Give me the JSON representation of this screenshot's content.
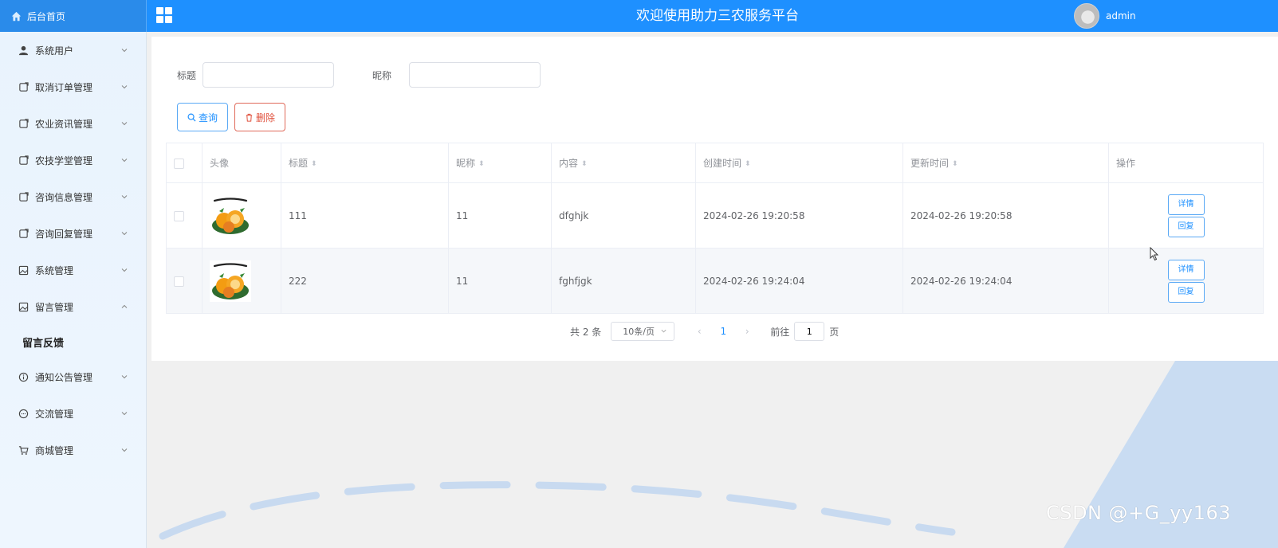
{
  "header": {
    "brand_label": "后台首页",
    "title": "欢迎使用助力三农服务平台",
    "username": "admin"
  },
  "sidebar": {
    "items": [
      {
        "label": "系统用户",
        "icon": "user-icon"
      },
      {
        "label": "取消订单管理",
        "icon": "document-icon"
      },
      {
        "label": "农业资讯管理",
        "icon": "document-icon"
      },
      {
        "label": "农技学堂管理",
        "icon": "document-icon"
      },
      {
        "label": "咨询信息管理",
        "icon": "document-icon"
      },
      {
        "label": "咨询回复管理",
        "icon": "document-icon"
      },
      {
        "label": "系统管理",
        "icon": "picture-icon"
      },
      {
        "label": "留言管理",
        "icon": "picture-icon",
        "expanded": true
      },
      {
        "label": "通知公告管理",
        "icon": "info-icon"
      },
      {
        "label": "交流管理",
        "icon": "chat-icon"
      },
      {
        "label": "商城管理",
        "icon": "cart-icon"
      }
    ],
    "sub_item": "留言反馈"
  },
  "search": {
    "title_label": "标题",
    "title_value": "",
    "nickname_label": "昵称",
    "nickname_value": "",
    "query_button": "查询",
    "delete_button": "删除"
  },
  "table": {
    "columns": [
      "头像",
      "标题",
      "昵称",
      "内容",
      "创建时间",
      "更新时间",
      "操作"
    ],
    "rows": [
      {
        "title": "111",
        "nickname": "11",
        "content": "dfghjk",
        "created": "2024-02-26 19:20:58",
        "updated": "2024-02-26 19:20:58",
        "detail": "详情",
        "reply": "回复"
      },
      {
        "title": "222",
        "nickname": "11",
        "content": "fghfjgk",
        "created": "2024-02-26 19:24:04",
        "updated": "2024-02-26 19:24:04",
        "detail": "详情",
        "reply": "回复"
      }
    ]
  },
  "pagination": {
    "total": "共 2 条",
    "page_size": "10条/页",
    "current_page": "1",
    "goto_label": "前往",
    "goto_value": "1",
    "page_suffix": "页"
  },
  "watermark": "CSDN @+G_yy163",
  "colors": {
    "primary": "#1e90ff",
    "danger": "#e0503c",
    "sidebar_bg": "#eaf4fd"
  }
}
